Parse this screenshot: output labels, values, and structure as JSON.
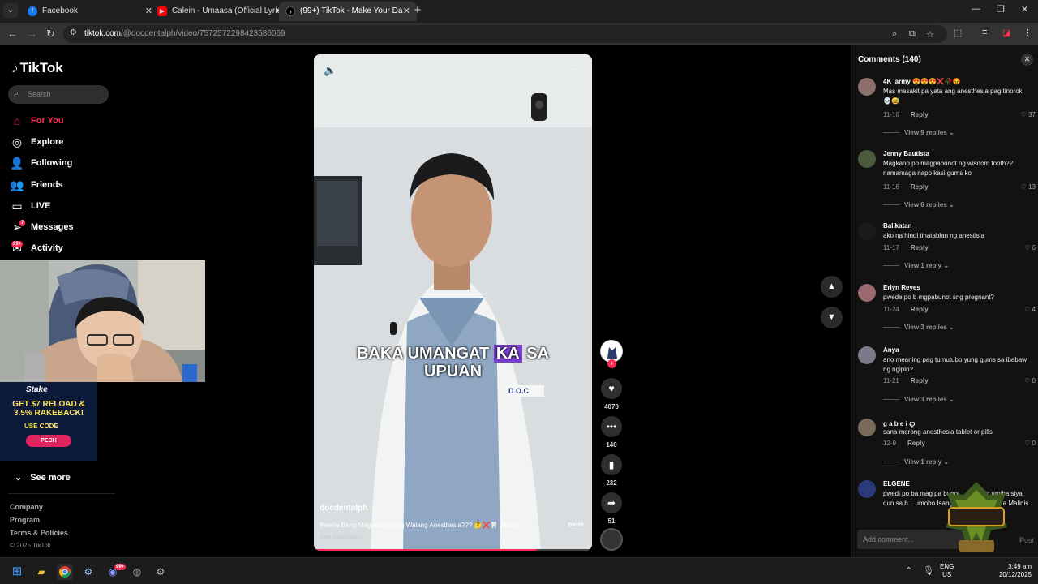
{
  "browser": {
    "tabs": [
      {
        "title": "Facebook",
        "icon": "facebook-icon",
        "color": "#1877f2"
      },
      {
        "title": "Calein - Umaasa (Official Lyric V",
        "icon": "youtube-icon",
        "color": "#ff0000"
      },
      {
        "title": "(99+) TikTok - Make Your Da",
        "icon": "tiktok-icon",
        "color": "#000000"
      }
    ],
    "url_host": "tiktok.com",
    "url_path": "/@docdentalph/video/7572572298423586069"
  },
  "sidebar": {
    "logo": "TikTok",
    "search_placeholder": "Search",
    "items": [
      {
        "label": "For You",
        "icon": "home-icon"
      },
      {
        "label": "Explore",
        "icon": "compass-icon"
      },
      {
        "label": "Following",
        "icon": "following-icon"
      },
      {
        "label": "Friends",
        "icon": "friends-icon"
      },
      {
        "label": "LIVE",
        "icon": "live-icon"
      },
      {
        "label": "Messages",
        "icon": "messages-icon",
        "badge": "7"
      },
      {
        "label": "Activity",
        "icon": "activity-icon",
        "badge": "99+"
      }
    ],
    "see_more": "See more",
    "footer": [
      "Company",
      "Program",
      "Terms & Policies"
    ],
    "copyright": "© 2025 TikTok"
  },
  "ad": {
    "brand": "Stake",
    "headline": "GET $7 RELOAD & 3.5% RAKEBACK!",
    "use_code": "USE CODE",
    "code": "PECH"
  },
  "video": {
    "caption_before": "BAKA UMANGAT",
    "caption_highlight": "KA",
    "caption_after": "SA",
    "caption_line2": "UPUAN",
    "badge_text": "D.O.C.",
    "author": "docdentalph",
    "description": "Pwede Bang Magpabunot Ng Walang Anesthesia??? 🤔❌🦷 #Bunot ...",
    "more": "more",
    "see_translation": "See translation",
    "progress": 0.8
  },
  "actions": {
    "likes": "4070",
    "comments": "140",
    "saves": "232",
    "shares": "51"
  },
  "comments": {
    "title": "Comments (140)",
    "items": [
      {
        "user": "4K_army 😍😍😍❌🥀😡",
        "text": "Mas masakit pa yata ang anesthesia pag tinorok 💀😅",
        "date": "11-16",
        "likes": "37",
        "replies": "View 9 replies",
        "avatar_color": "#8a6f6a"
      },
      {
        "user": "Jenny Bautista",
        "text": "Magkano po magpabunot ng wisdom tooth?? namamaga napo kasi gums ko",
        "date": "11-16",
        "likes": "13",
        "replies": "View 6 replies",
        "avatar_color": "#4a5a3a"
      },
      {
        "user": "Balikatan",
        "text": "ako na hindi tinatablan ng anestisia",
        "date": "11-17",
        "likes": "6",
        "replies": "View 1 reply",
        "avatar_color": "#1a1a1a"
      },
      {
        "user": "Erlyn Reyes",
        "text": "pwede po b mgpabunot sng pregnant?",
        "date": "11-24",
        "likes": "4",
        "replies": "View 3 replies",
        "avatar_color": "#9a6a70"
      },
      {
        "user": "Anya",
        "text": "ano meaning pag tumutubo yung gums sa ibabaw ng ngipin?",
        "date": "11-21",
        "likes": "0",
        "replies": "View 3 replies",
        "avatar_color": "#7a7a8a"
      },
      {
        "user": "g a b e i ꨄ",
        "text": "sana merong anesthesia tablet or pills",
        "date": "12-9",
        "likes": "0",
        "replies": "View 1 reply",
        "avatar_color": "#7a6a5a"
      },
      {
        "user": "ELGENE",
        "text": "pwedi po ba mag pa bunot ... nginpin umiba siya dun sa b... umobo Isang tanong kupa p... a Malinis",
        "date": "",
        "likes": "",
        "replies": "",
        "avatar_color": "#2a3a7a"
      }
    ],
    "reply_label": "Reply",
    "input_placeholder": "Add comment...",
    "post": "Post"
  },
  "overlay_logo": "DSOURCE CITY",
  "taskbar": {
    "lang_top": "ENG",
    "lang_bottom": "US",
    "time": "3:49 am",
    "date": "20/12/2025",
    "discord_badge": "99+"
  }
}
